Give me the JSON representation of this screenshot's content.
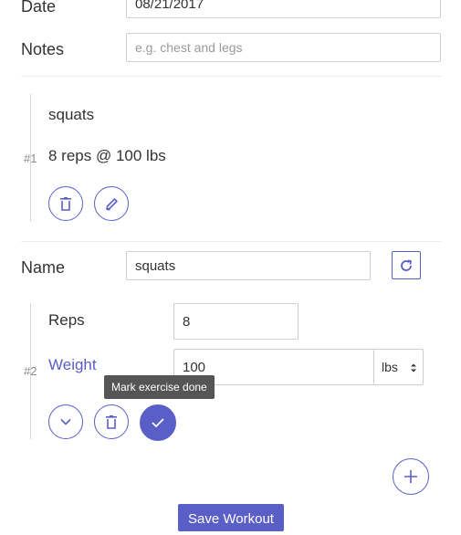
{
  "form": {
    "date_label": "Date",
    "date_value": "08/21/2017",
    "notes_label": "Notes",
    "notes_placeholder": "e.g. chest and legs"
  },
  "exercise1": {
    "number": "#1",
    "name": "squats",
    "summary": "8 reps @ 100 lbs",
    "delete_icon": "trash-icon",
    "edit_icon": "pencil-icon"
  },
  "exercise2": {
    "number": "#2",
    "name_label": "Name",
    "name_value": "squats",
    "reps_label": "Reps",
    "reps_value": "8",
    "weight_label": "Weight",
    "weight_value": "100",
    "unit_options": [
      "lbs"
    ],
    "unit_selected": "lbs",
    "tooltip": "Mark exercise done",
    "accent": "#5a5fc7"
  },
  "actions": {
    "save_label": "Save Workout"
  }
}
